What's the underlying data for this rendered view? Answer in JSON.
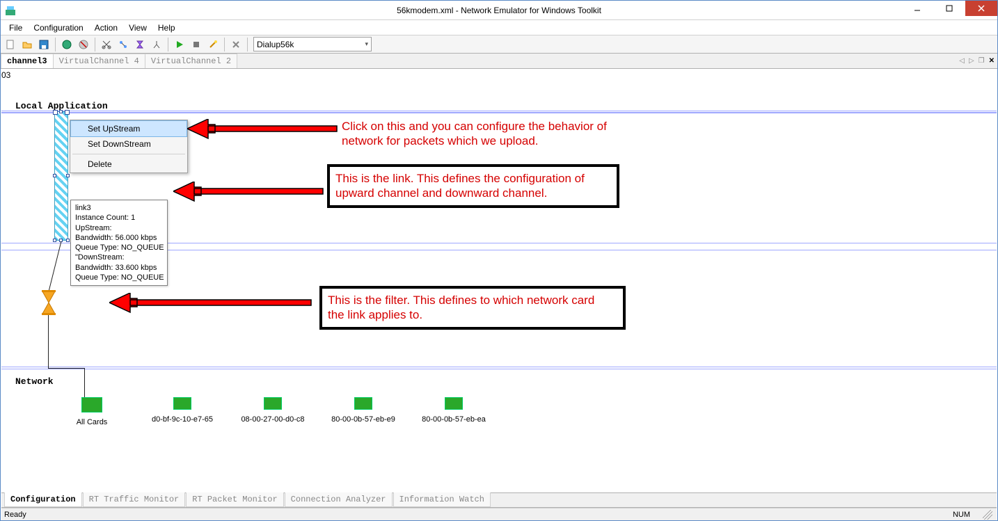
{
  "window": {
    "title": "56kmodem.xml - Network Emulator for Windows Toolkit"
  },
  "menu": {
    "items": [
      "File",
      "Configuration",
      "Action",
      "View",
      "Help"
    ]
  },
  "toolbar": {
    "icons": [
      "new",
      "open",
      "save",
      "globe",
      "stop-globe",
      "scissors",
      "flow",
      "hourglass",
      "branch",
      "play",
      "stop-sq",
      "wand",
      "settings"
    ],
    "dropdown_value": "Dialup56k"
  },
  "channel_tabs": {
    "items": [
      "channel3",
      "VirtualChannel 4",
      "VirtualChannel 2"
    ],
    "active_index": 0
  },
  "canvas": {
    "local_label": "Local Application",
    "network_label": "Network",
    "context_menu": {
      "items": [
        "Set UpStream",
        "Set DownStream"
      ],
      "extra": "Delete",
      "highlight_index": 0
    },
    "tooltip_lines": [
      "link3",
      "Instance Count: 1",
      "UpStream:",
      "Bandwidth: 56.000 kbps",
      "Queue Type: NO_QUEUE",
      "\"DownStream:",
      "Bandwidth: 33.600 kbps",
      "Queue Type: NO_QUEUE"
    ],
    "cards": [
      "All Cards",
      "d0-bf-9c-10-e7-65",
      "08-00-27-00-d0-c8",
      "80-00-0b-57-eb-e9",
      "80-00-0b-57-eb-ea"
    ]
  },
  "annotations": {
    "a1_line1": "Click on this and you can configure the behavior of",
    "a1_line2": "network for packets which we upload.",
    "a2_line1": "This is the link. This defines the configuration of",
    "a2_line2": "upward channel and downward channel.",
    "a3_line1": "This is the filter. This defines to which network card",
    "a3_line2": "the link applies to."
  },
  "bottom_tabs": {
    "items": [
      "Configuration",
      "RT Traffic Monitor",
      "RT Packet Monitor",
      "Connection Analyzer",
      "Information Watch"
    ],
    "active_index": 0
  },
  "status": {
    "left": "Ready",
    "right": "NUM"
  }
}
